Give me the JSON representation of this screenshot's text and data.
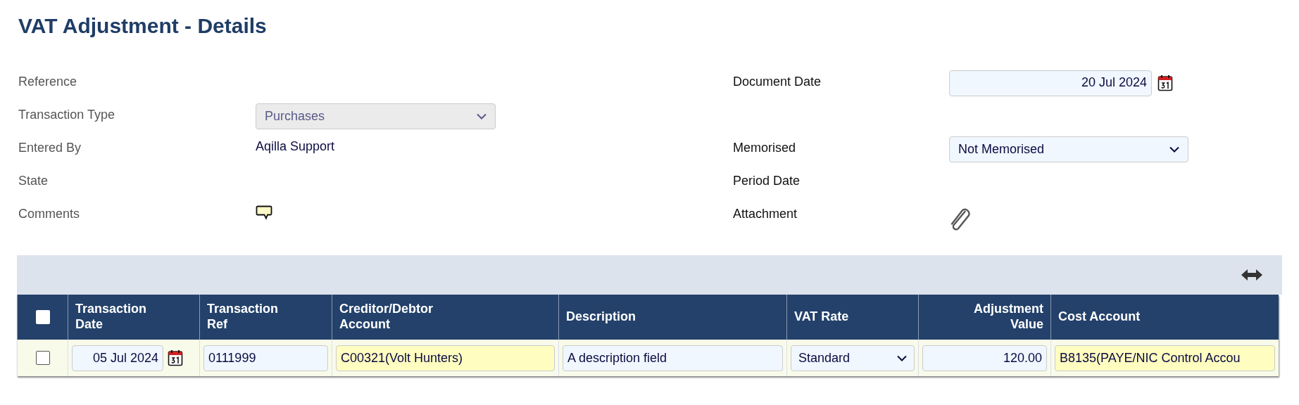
{
  "title": "VAT Adjustment - Details",
  "rows": [
    {
      "left": {
        "label": "Reference",
        "kind": "empty"
      },
      "right": {
        "label": "Document Date",
        "kind": "date",
        "value": "20 Jul 2024"
      }
    },
    {
      "left": {
        "label": "Transaction Type",
        "kind": "select",
        "value": "Purchases",
        "disabled": true
      }
    },
    {
      "left": {
        "label": "Entered By",
        "kind": "text",
        "value": "Aqilla Support"
      },
      "right": {
        "label": "Memorised",
        "kind": "select",
        "value": "Not Memorised",
        "disabled": false
      }
    },
    {
      "left": {
        "label": "State",
        "kind": "empty"
      },
      "right": {
        "label": "Period Date",
        "kind": "empty"
      }
    },
    {
      "left": {
        "label": "Comments",
        "kind": "comment"
      },
      "right": {
        "label": "Attachment",
        "kind": "attachment"
      }
    }
  ],
  "table": {
    "select_all": {
      "checked": false
    },
    "columns": [
      {
        "label": "Transaction Date"
      },
      {
        "label": "Transaction Ref"
      },
      {
        "label": "Creditor/Debtor Account"
      },
      {
        "label": "Description"
      },
      {
        "label": "VAT Rate"
      },
      {
        "label": "Adjustment Value"
      },
      {
        "label": "Cost Account"
      }
    ],
    "rows": [
      {
        "checked": false,
        "cells": [
          {
            "kind": "date",
            "value": "05 Jul 2024"
          },
          {
            "kind": "text",
            "value": "0111999"
          },
          {
            "kind": "lookup",
            "value": "C00321(Volt Hunters)"
          },
          {
            "kind": "text",
            "value": "A description field"
          },
          {
            "kind": "select",
            "value": "Standard"
          },
          {
            "kind": "number",
            "value": "120.00"
          },
          {
            "kind": "lookup",
            "value": "B8135(PAYE/NIC Control Accou"
          }
        ]
      }
    ]
  }
}
